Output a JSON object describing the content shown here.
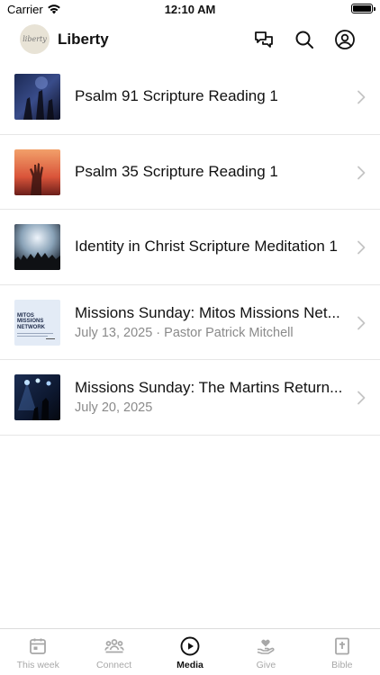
{
  "status_bar": {
    "carrier": "Carrier",
    "time": "12:10 AM"
  },
  "header": {
    "logo_text": "liberty",
    "title": "Liberty"
  },
  "media_items": [
    {
      "title": "Psalm 91 Scripture Reading 1",
      "subtitle": "",
      "thumb": "concert-hands"
    },
    {
      "title": "Psalm 35 Scripture Reading 1",
      "subtitle": "",
      "thumb": "raised-hand"
    },
    {
      "title": "Identity in Christ Scripture Meditation 1",
      "subtitle": "",
      "thumb": "crowd-lights"
    },
    {
      "title": "Missions Sunday: Mitos Missions Net...",
      "subtitle": "July 13, 2025 · Pastor Patrick Mitchell",
      "thumb": "mitos-card"
    },
    {
      "title": "Missions Sunday: The Martins Return...",
      "subtitle": "July 20, 2025",
      "thumb": "stage-lights"
    }
  ],
  "mitos_card": {
    "line1": "MITOS",
    "line2": "MISSIONS",
    "line3": "NETWORK"
  },
  "tabs": [
    {
      "label": "This week",
      "icon": "calendar-icon",
      "active": false
    },
    {
      "label": "Connect",
      "icon": "people-icon",
      "active": false
    },
    {
      "label": "Media",
      "icon": "play-circle-icon",
      "active": true
    },
    {
      "label": "Give",
      "icon": "heart-hand-icon",
      "active": false
    },
    {
      "label": "Bible",
      "icon": "bible-icon",
      "active": false
    }
  ],
  "colors": {
    "active_tab": "#111111",
    "inactive_tab": "#a8a8a8",
    "divider": "#e6e6e6",
    "subtitle": "#8a8a8a"
  }
}
